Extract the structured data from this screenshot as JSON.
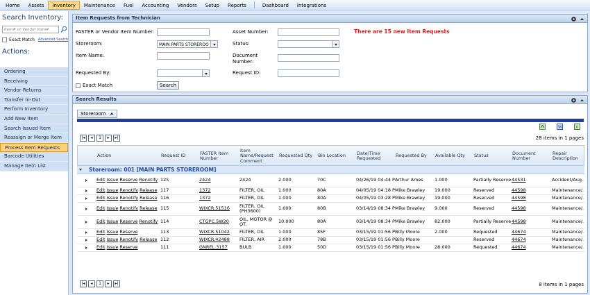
{
  "menu": [
    {
      "label": "Home",
      "active": false
    },
    {
      "label": "Assets",
      "active": false
    },
    {
      "label": "Inventory",
      "active": true
    },
    {
      "label": "Maintenance",
      "active": false
    },
    {
      "label": "Fuel",
      "active": false
    },
    {
      "label": "Accounting",
      "active": false
    },
    {
      "label": "Vendors",
      "active": false
    },
    {
      "label": "Setup",
      "active": false
    },
    {
      "label": "Reports",
      "active": false
    },
    {
      "label": "Dashboard",
      "active": false
    },
    {
      "label": "Integrations",
      "active": false
    }
  ],
  "sidebar": {
    "search_title": "Search Inventory:",
    "search_placeholder": "Item# or Vendor Item#",
    "exact_match_label": "Exact Match",
    "advanced_search_label": "Advanced Search",
    "actions_title": "Actions:",
    "actions": [
      {
        "label": "Ordering",
        "selected": false
      },
      {
        "label": "Receiving",
        "selected": false
      },
      {
        "label": "Vendor Returns",
        "selected": false
      },
      {
        "label": "Transfer In-Out",
        "selected": false
      },
      {
        "label": "Perform Inventory",
        "selected": false
      },
      {
        "label": "Add New Item",
        "selected": false
      },
      {
        "label": "Search Issued Item",
        "selected": false
      },
      {
        "label": "Reassign or Merge Item",
        "selected": false
      },
      {
        "label": "Process Item Requests",
        "selected": true
      },
      {
        "label": "Barcode Utilities",
        "selected": false
      },
      {
        "label": "Manage Item List",
        "selected": false
      }
    ]
  },
  "requests_panel": {
    "title": "Item Requests from Technician",
    "notice": "There are 15 new Item Requests",
    "fields": {
      "faster_item_label": "FASTER or Vendor Item Number:",
      "faster_item_value": "",
      "storeroom_label": "Storeroom:",
      "storeroom_value": "MAIN PARTS STOREROOM",
      "item_name_label": "Item Name:",
      "item_name_value": "",
      "requested_by_label": "Requested By:",
      "requested_by_value": "",
      "asset_number_label": "Asset Number:",
      "asset_number_value": "",
      "status_label": "Status:",
      "status_value": "",
      "document_number_label": "Document Number:",
      "document_number_value": "",
      "request_id_label": "Request ID:",
      "request_id_value": ""
    },
    "exact_match_label": "Exact Match",
    "search_button": "Search"
  },
  "results_panel": {
    "title": "Search Results",
    "group_by_chip": "Storeroom",
    "page_info_top": "28 items in 1 pages",
    "page_info_bottom": "8 items in 1 pages",
    "pager_current": "1",
    "columns": [
      "Action",
      "Request ID",
      "FASTER Item Number",
      "Item Name/Request Comment",
      "Requested Qty",
      "Bin Location",
      "Date/Time Requested",
      "Requested By",
      "Available Qty",
      "Status",
      "Document Number",
      "Repair Description"
    ],
    "group_label": "Storeroom: 001 [MAIN PARTS STOREROOM]",
    "rows": [
      {
        "actions": [
          "Edit",
          "Issue",
          "Reserve",
          "Renotify",
          "Release"
        ],
        "request_id": "125",
        "item_number": "2424",
        "item_name": "2424",
        "qty": "2.000",
        "bin": "70C",
        "datetime": "04/26/19 04:44 P",
        "requested_by": "Arthur Ames",
        "available": "1.000",
        "status": "Partially Reserved",
        "doc": "44531",
        "repair": "Accident/Aug..."
      },
      {
        "actions": [
          "Edit",
          "Issue",
          "Renotify",
          "Release"
        ],
        "request_id": "117",
        "item_number": "1372",
        "item_name": "FILTER, OIL",
        "qty": "1.000",
        "bin": "80A",
        "datetime": "04/05/19 04:18 P",
        "requested_by": "Mike Brawley",
        "available": "19.000",
        "status": "Reserved",
        "doc": "44598",
        "repair": "Maintenance/..."
      },
      {
        "actions": [
          "Edit",
          "Issue",
          "Renotify",
          "Release"
        ],
        "request_id": "116",
        "item_number": "1372",
        "item_name": "FILTER, OIL",
        "qty": "1.000",
        "bin": "80A",
        "datetime": "04/05/19 03:28 P",
        "requested_by": "Mike Brawley",
        "available": "19.000",
        "status": "Reserved",
        "doc": "44598",
        "repair": "Maintenance/..."
      },
      {
        "actions": [
          "Edit",
          "Issue",
          "Renotify",
          "Release"
        ],
        "request_id": "115",
        "item_number": "WIXCR.51516",
        "item_name": "FILTER, OIL (PH3600)",
        "qty": "1.000",
        "bin": "80B",
        "datetime": "03/14/19 08:34 P",
        "requested_by": "Mike Brawley",
        "available": "9.000",
        "status": "Reserved",
        "doc": "44598",
        "repair": "Maintenance/..."
      },
      {
        "actions": [
          "Edit",
          "Issue",
          "Reserve",
          "Renotify",
          "Release"
        ],
        "request_id": "114",
        "item_number": "CTGPC.5W20",
        "item_name": "OIL, MOTOR @ QT.",
        "qty": "10.000",
        "bin": "80A",
        "datetime": "03/14/19 08:34 P",
        "requested_by": "Mike Brawley",
        "available": "82.000",
        "status": "Partially Reserved",
        "doc": "44598",
        "repair": "Maintenance/..."
      },
      {
        "actions": [
          "Edit",
          "Issue",
          "Reserve"
        ],
        "request_id": "113",
        "item_number": "WIXCR.51042",
        "item_name": "FILTER, OIL",
        "qty": "1.000",
        "bin": "85F",
        "datetime": "03/15/19 01:56 P",
        "requested_by": "Billy Moore",
        "available": "2.000",
        "status": "Requested",
        "doc": "44674",
        "repair": "Maintenance/..."
      },
      {
        "actions": [
          "Edit",
          "Issue",
          "Renotify",
          "Release"
        ],
        "request_id": "112",
        "item_number": "WIXCR.42488",
        "item_name": "FILTER, AIR",
        "qty": "2.000",
        "bin": "78B",
        "datetime": "03/15/19 01:56 P",
        "requested_by": "Billy Moore",
        "available": "",
        "status": "Reserved",
        "doc": "44674",
        "repair": "Maintenance/..."
      },
      {
        "actions": [
          "Edit",
          "Issue",
          "Reserve"
        ],
        "request_id": "111",
        "item_number": "GNREL.3157",
        "item_name": "BULB",
        "qty": "1.000",
        "bin": "50D",
        "datetime": "03/15/19 01:56 P",
        "requested_by": "Billy Moore",
        "available": "28.000",
        "status": "Requested",
        "doc": "44674",
        "repair": "Maintenance/..."
      }
    ]
  },
  "colors": {
    "notice": "#e02020",
    "selected_action": "#ffd27a",
    "group_text": "#1e4aa8",
    "header_bar": "#1f3f9c"
  }
}
